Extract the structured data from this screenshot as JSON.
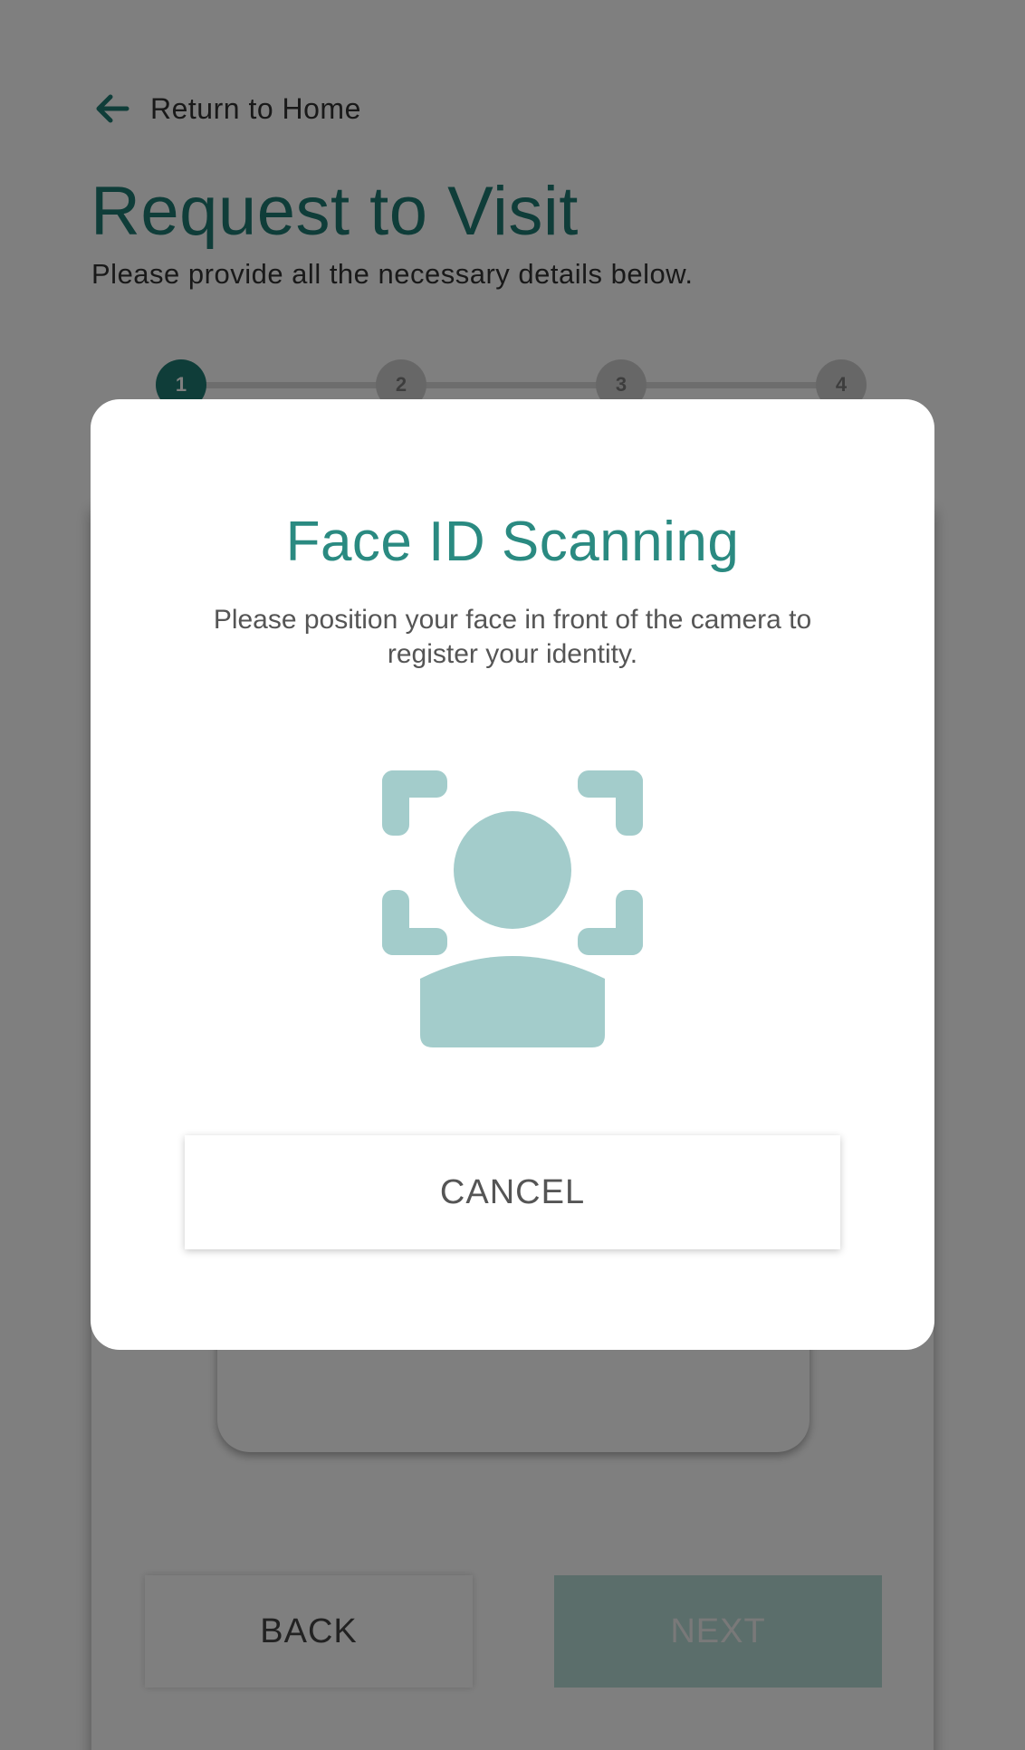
{
  "header": {
    "back_link_label": "Return to Home",
    "title": "Request to Visit",
    "subtitle": "Please provide all the necessary details below."
  },
  "stepper": {
    "steps": [
      "1",
      "2",
      "3",
      "4"
    ],
    "active_step": "1"
  },
  "form_actions": {
    "back_label": "BACK",
    "next_label": "NEXT"
  },
  "modal": {
    "title": "Face ID Scanning",
    "message": "Please position your face in front of the camera to register your identity.",
    "icon": "face-scan-icon",
    "cancel_label": "CANCEL"
  },
  "colors": {
    "primary": "#1f7a72",
    "modal_title": "#2a8a81",
    "face_icon": "#a3cccb",
    "overlay": "rgba(0,0,0,0.5)"
  }
}
